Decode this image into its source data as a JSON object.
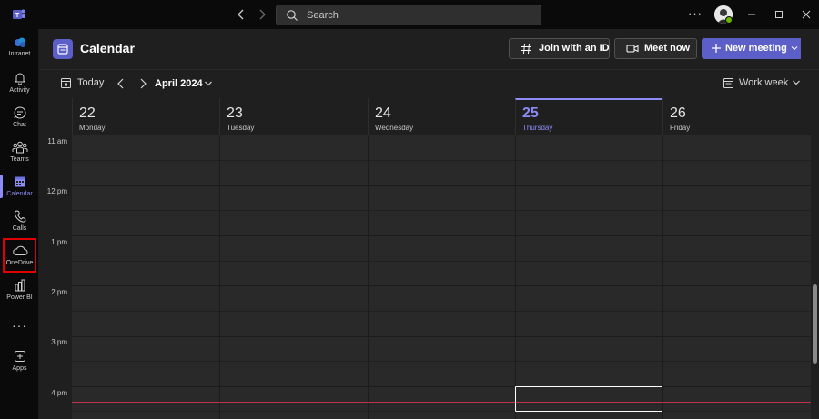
{
  "titlebar": {
    "search_placeholder": "Search",
    "more_label": "···"
  },
  "rail": {
    "items": [
      {
        "label": "Intranet",
        "icon": "intranet-icon"
      },
      {
        "label": "Activity",
        "icon": "bell-icon"
      },
      {
        "label": "Chat",
        "icon": "chat-icon"
      },
      {
        "label": "Teams",
        "icon": "teams-icon"
      },
      {
        "label": "Calendar",
        "icon": "calendar-icon",
        "active": true
      },
      {
        "label": "Calls",
        "icon": "phone-icon"
      },
      {
        "label": "OneDrive",
        "icon": "cloud-icon",
        "highlighted": true
      },
      {
        "label": "Power BI",
        "icon": "powerbi-icon"
      },
      {
        "label": "···",
        "icon": "more-icon"
      },
      {
        "label": "Apps",
        "icon": "apps-icon"
      }
    ]
  },
  "header": {
    "title": "Calendar",
    "join_label": "Join with an ID",
    "meet_label": "Meet now",
    "new_meeting_label": "New meeting"
  },
  "toolbar": {
    "today_label": "Today",
    "month_label": "April 2024",
    "view_label": "Work week"
  },
  "days": [
    {
      "num": "22",
      "name": "Monday"
    },
    {
      "num": "23",
      "name": "Tuesday"
    },
    {
      "num": "24",
      "name": "Wednesday"
    },
    {
      "num": "25",
      "name": "Thursday",
      "today": true
    },
    {
      "num": "26",
      "name": "Friday"
    }
  ],
  "times": [
    "11 am",
    "12 pm",
    "1 pm",
    "2 pm",
    "3 pm",
    "4 pm"
  ],
  "colors": {
    "accent": "#5b5fc7",
    "accent_light": "#8b8cf5",
    "now_line": "#c4314b",
    "highlight": "#e00000"
  }
}
